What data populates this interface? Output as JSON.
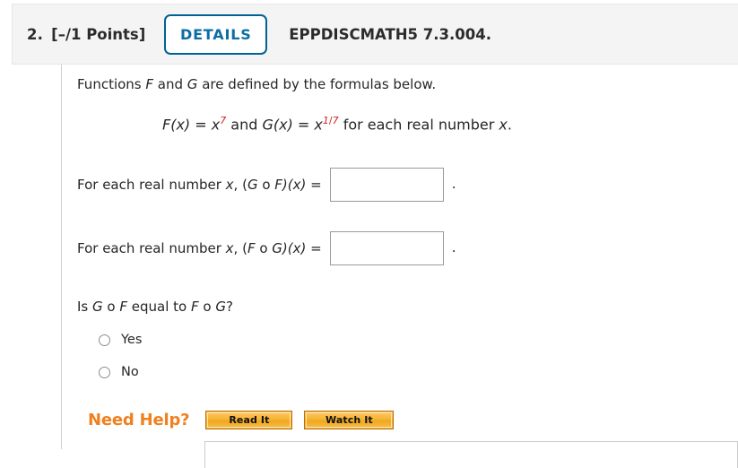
{
  "header": {
    "number": "2.",
    "points": "[–/1 Points]",
    "details_label": "DETAILS",
    "assignment_code": "EPPDISCMATH5 7.3.004.",
    "accent_blue": "#006294",
    "bar_background": "#f4f4f4"
  },
  "question": {
    "intro_before": "Functions ",
    "intro_f": "F",
    "intro_mid": " and ",
    "intro_g": "G",
    "intro_after": " are defined by the formulas below.",
    "formula": {
      "f_name": "F",
      "f_arg": "(x) = ",
      "f_base": "x",
      "f_exponent": "7",
      "conjunction": " and  ",
      "g_name": "G",
      "g_arg": "(x) = ",
      "g_base": "x",
      "g_exponent_num": "1",
      "g_exponent_slash": "/",
      "g_exponent_den": "7",
      "tail_before_x": " for each real number ",
      "tail_x": "x",
      "tail_after": ".",
      "exponent_color": "#d02020"
    },
    "answers": [
      {
        "prefix": "For each real number ",
        "var": "x",
        "comma": ", (",
        "fn_first": "G",
        "circ": " o ",
        "fn_second": "F",
        "suffix": ")(x) = ",
        "value": "",
        "placeholder": "",
        "period": "."
      },
      {
        "prefix": "For each real number ",
        "var": "x",
        "comma": ", (",
        "fn_first": "F",
        "circ": " o ",
        "fn_second": "G",
        "suffix": ")(x) = ",
        "value": "",
        "placeholder": "",
        "period": "."
      }
    ],
    "equality_question": {
      "lead": "Is ",
      "first_a": "G",
      "circ_a": " o ",
      "first_b": "F",
      "middle": " equal to ",
      "second_a": "F",
      "circ_b": " o ",
      "second_b": "G",
      "tail": "?"
    },
    "choices": [
      {
        "label": "Yes",
        "selected": false
      },
      {
        "label": "No",
        "selected": false
      }
    ]
  },
  "need_help": {
    "label": "Need Help?",
    "label_color": "#f08020",
    "buttons": [
      {
        "label": "Read It",
        "icon": "read-it-icon"
      },
      {
        "label": "Watch It",
        "icon": "watch-it-icon"
      }
    ]
  }
}
